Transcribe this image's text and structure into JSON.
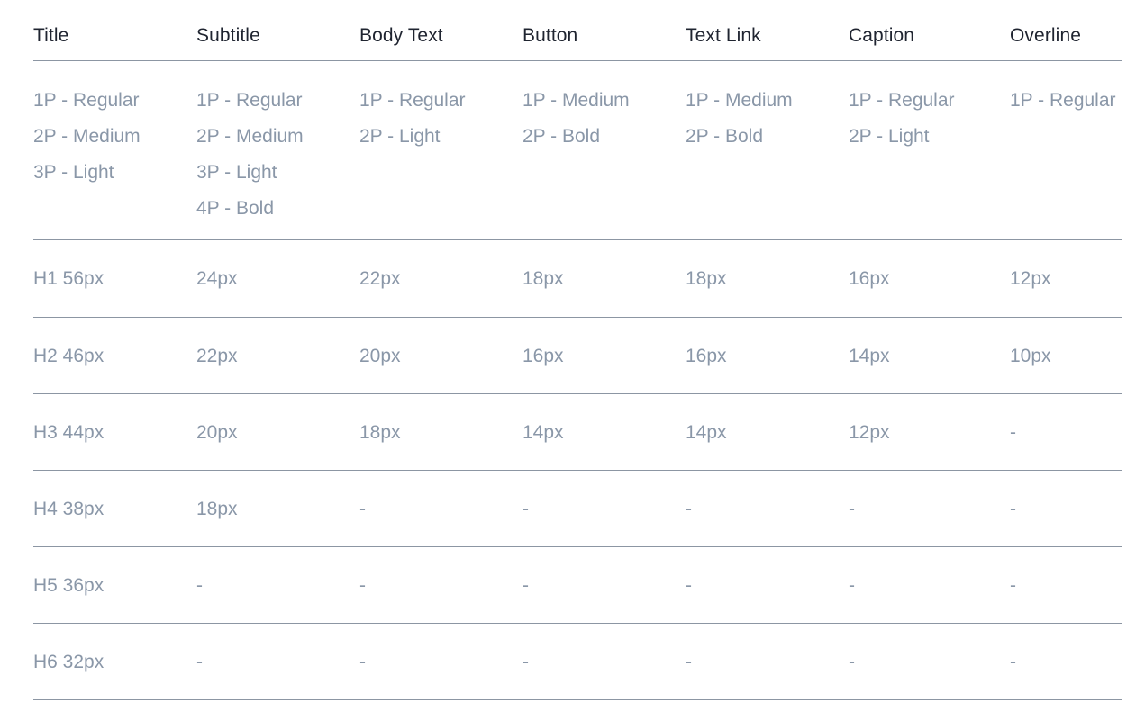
{
  "columns": [
    "Title",
    "Subtitle",
    "Body Text",
    "Button",
    "Text Link",
    "Caption",
    "Overline"
  ],
  "weights": [
    [
      "1P - Regular",
      "2P - Medium",
      "3P - Light"
    ],
    [
      "1P - Regular",
      "2P - Medium",
      "3P - Light",
      "4P - Bold"
    ],
    [
      "1P - Regular",
      "2P - Light"
    ],
    [
      "1P - Medium",
      "2P - Bold"
    ],
    [
      "1P - Medium",
      "2P - Bold"
    ],
    [
      "1P - Regular",
      "2P - Light"
    ],
    [
      "1P - Regular"
    ]
  ],
  "sizes": [
    [
      "H1 56px",
      "24px",
      "22px",
      "18px",
      "18px",
      "16px",
      "12px"
    ],
    [
      "H2 46px",
      "22px",
      "20px",
      "16px",
      "16px",
      "14px",
      "10px"
    ],
    [
      "H3 44px",
      "20px",
      "18px",
      "14px",
      "14px",
      "12px",
      "-"
    ],
    [
      "H4 38px",
      "18px",
      "-",
      "-",
      "-",
      "-",
      "-"
    ],
    [
      "H5 36px",
      "-",
      "-",
      "-",
      "-",
      "-",
      "-"
    ],
    [
      "H6 32px",
      "-",
      "-",
      "-",
      "-",
      "-",
      "-"
    ]
  ],
  "colors": {
    "header_text": "#1f2430",
    "muted_text": "#8a97a8",
    "divider": "#8c96a3"
  }
}
